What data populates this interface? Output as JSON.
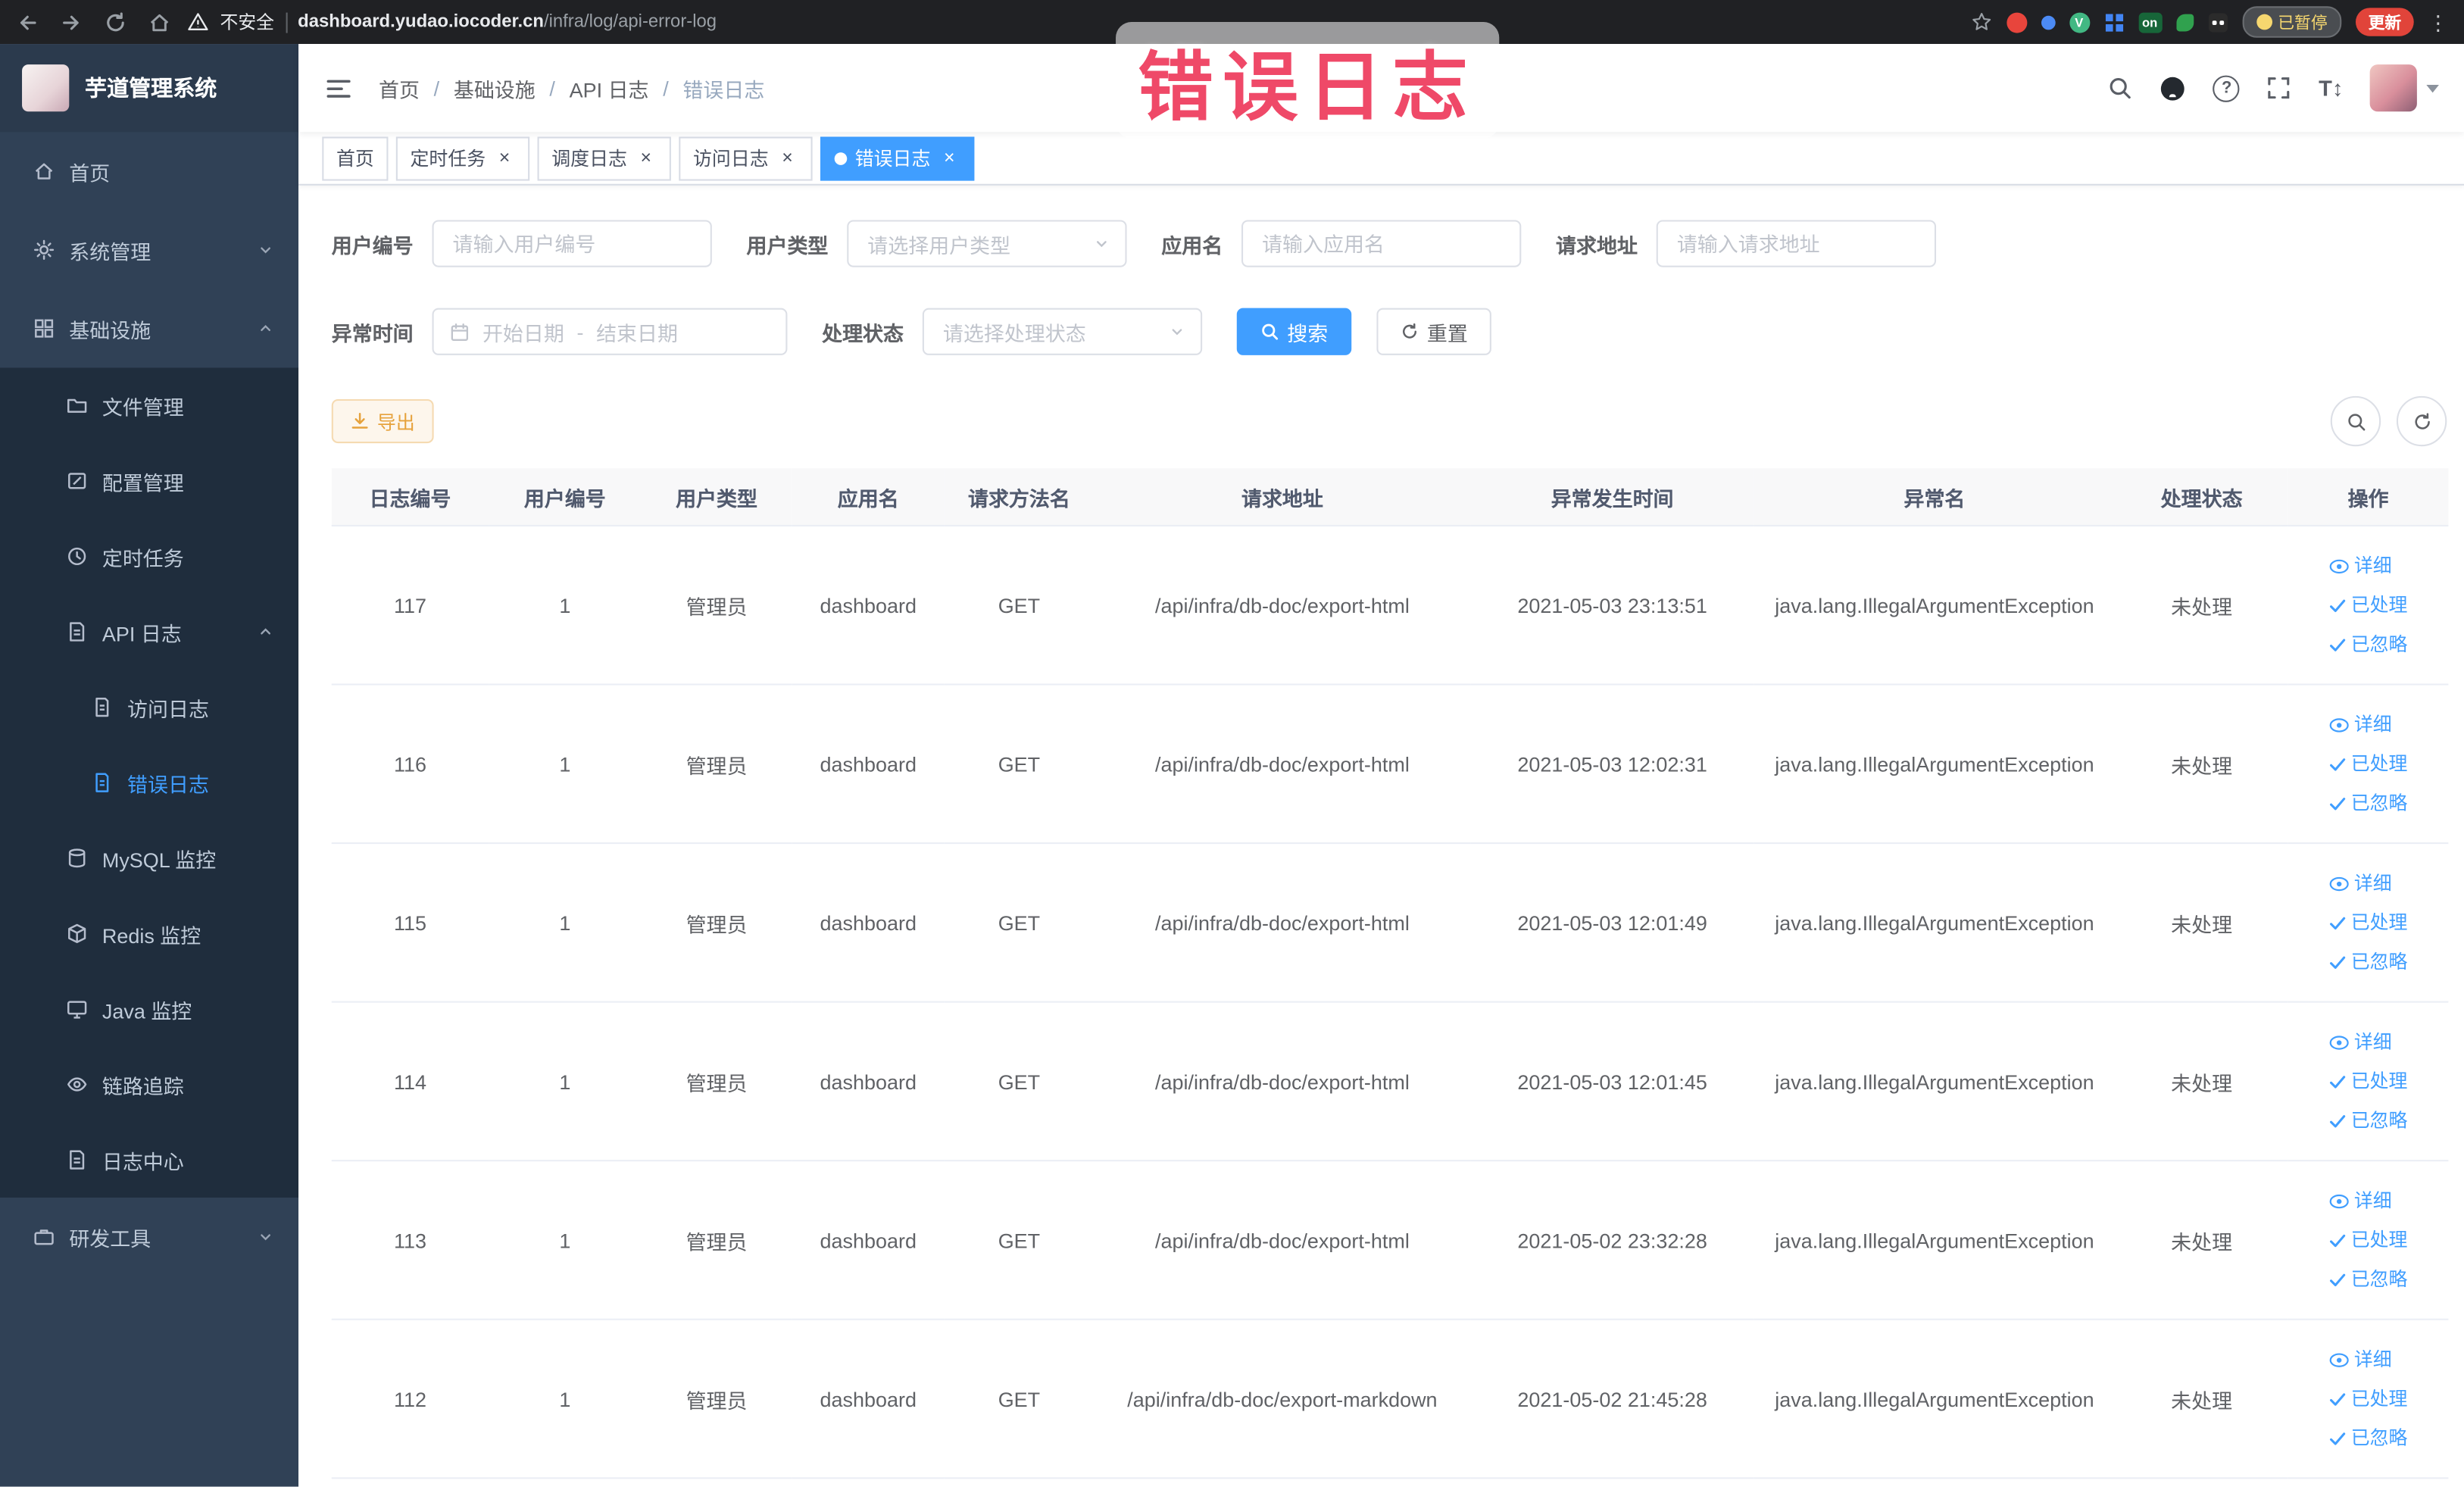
{
  "colors": {
    "accent": "#409eff",
    "annotation": "#ef4968",
    "warning": "#e6a23c",
    "update_button": "#e1443a",
    "sidebar_bg": "#304156",
    "submenu_bg": "#1f2d3d"
  },
  "browser": {
    "security_label": "不安全",
    "url_domain": "dashboard.yudao.iocoder.cn",
    "url_path": "/infra/log/api-error-log",
    "paused_badge": "已暂停",
    "update_button": "更新",
    "ext_v_label": "V",
    "ext_on_label": "on"
  },
  "annotation": {
    "text": "错误日志"
  },
  "sidebar": {
    "logo_title": "芋道管理系统",
    "home": "首页",
    "system_mgmt": "系统管理",
    "infrastructure": "基础设施",
    "file_mgmt": "文件管理",
    "config_mgmt": "配置管理",
    "scheduled_jobs": "定时任务",
    "api_logs": "API 日志",
    "access_log": "访问日志",
    "error_log": "错误日志",
    "mysql_monitor": "MySQL 监控",
    "redis_monitor": "Redis 监控",
    "java_monitor": "Java 监控",
    "tracing": "链路追踪",
    "log_center": "日志中心",
    "dev_tools": "研发工具"
  },
  "header": {
    "breadcrumbs": [
      "首页",
      "基础设施",
      "API 日志",
      "错误日志"
    ],
    "separator": "/"
  },
  "tabs": [
    {
      "label": "首页"
    },
    {
      "label": "定时任务"
    },
    {
      "label": "调度日志"
    },
    {
      "label": "访问日志"
    },
    {
      "label": "错误日志"
    }
  ],
  "filters": {
    "user_id_label": "用户编号",
    "user_id_placeholder": "请输入用户编号",
    "user_type_label": "用户类型",
    "user_type_placeholder": "请选择用户类型",
    "app_name_label": "应用名",
    "app_name_placeholder": "请输入应用名",
    "request_url_label": "请求地址",
    "request_url_placeholder": "请输入请求地址",
    "exception_time_label": "异常时间",
    "start_date_placeholder": "开始日期",
    "range_separator": "-",
    "end_date_placeholder": "结束日期",
    "process_status_label": "处理状态",
    "process_status_placeholder": "请选择处理状态",
    "search_button": "搜索",
    "reset_button": "重置"
  },
  "toolbar": {
    "export_button": "导出"
  },
  "table": {
    "headers": [
      "日志编号",
      "用户编号",
      "用户类型",
      "应用名",
      "请求方法名",
      "请求地址",
      "异常发生时间",
      "异常名",
      "处理状态",
      "操作"
    ],
    "actions": {
      "detail": "详细",
      "processed": "已处理",
      "ignored": "已忽略"
    },
    "rows": [
      {
        "id": "117",
        "user_id": "1",
        "user_type": "管理员",
        "app": "dashboard",
        "method": "GET",
        "url": "/api/infra/db-doc/export-html",
        "time": "2021-05-03 23:13:51",
        "exception": "java.lang.IllegalArgumentException",
        "status": "未处理"
      },
      {
        "id": "116",
        "user_id": "1",
        "user_type": "管理员",
        "app": "dashboard",
        "method": "GET",
        "url": "/api/infra/db-doc/export-html",
        "time": "2021-05-03 12:02:31",
        "exception": "java.lang.IllegalArgumentException",
        "status": "未处理"
      },
      {
        "id": "115",
        "user_id": "1",
        "user_type": "管理员",
        "app": "dashboard",
        "method": "GET",
        "url": "/api/infra/db-doc/export-html",
        "time": "2021-05-03 12:01:49",
        "exception": "java.lang.IllegalArgumentException",
        "status": "未处理"
      },
      {
        "id": "114",
        "user_id": "1",
        "user_type": "管理员",
        "app": "dashboard",
        "method": "GET",
        "url": "/api/infra/db-doc/export-html",
        "time": "2021-05-03 12:01:45",
        "exception": "java.lang.IllegalArgumentException",
        "status": "未处理"
      },
      {
        "id": "113",
        "user_id": "1",
        "user_type": "管理员",
        "app": "dashboard",
        "method": "GET",
        "url": "/api/infra/db-doc/export-html",
        "time": "2021-05-02 23:32:28",
        "exception": "java.lang.IllegalArgumentException",
        "status": "未处理"
      },
      {
        "id": "112",
        "user_id": "1",
        "user_type": "管理员",
        "app": "dashboard",
        "method": "GET",
        "url": "/api/infra/db-doc/export-markdown",
        "time": "2021-05-02 21:45:28",
        "exception": "java.lang.IllegalArgumentException",
        "status": "未处理"
      }
    ]
  }
}
